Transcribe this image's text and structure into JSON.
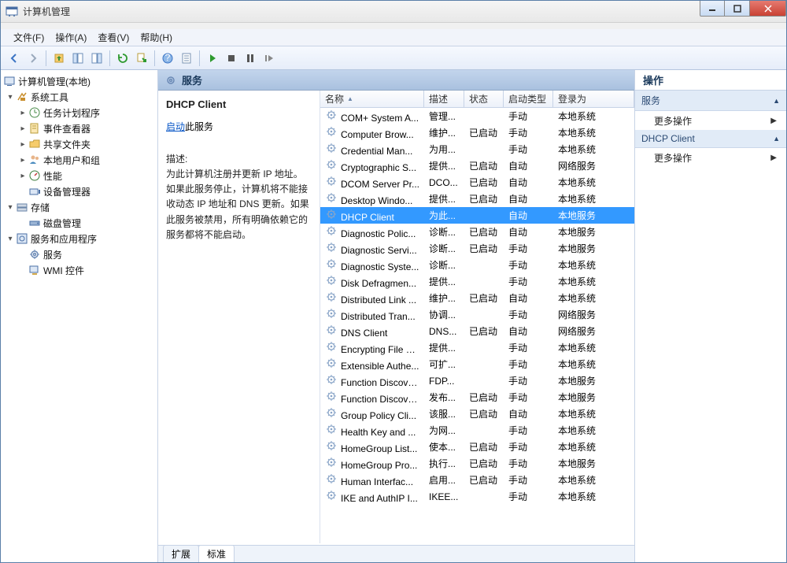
{
  "window": {
    "title": "计算机管理"
  },
  "menus": {
    "file": "文件(F)",
    "action": "操作(A)",
    "view": "查看(V)",
    "help": "帮助(H)"
  },
  "tree": {
    "root": "计算机管理(本地)",
    "sys_tools": "系统工具",
    "task_scheduler": "任务计划程序",
    "event_viewer": "事件查看器",
    "shared_folders": "共享文件夹",
    "local_users": "本地用户和组",
    "performance": "性能",
    "device_manager": "设备管理器",
    "storage": "存储",
    "disk_management": "磁盘管理",
    "services_apps": "服务和应用程序",
    "services": "服务",
    "wmi": "WMI 控件"
  },
  "content": {
    "header": "服务",
    "detail_title": "DHCP Client",
    "start_link_prefix": "启动",
    "start_link_suffix": "此服务",
    "desc_label": "描述:",
    "desc_text": "为此计算机注册并更新 IP 地址。如果此服务停止，计算机将不能接收动态 IP 地址和 DNS 更新。如果此服务被禁用，所有明确依赖它的服务都将不能启动。",
    "columns": {
      "name": "名称",
      "desc": "描述",
      "status": "状态",
      "startup": "启动类型",
      "logon": "登录为"
    },
    "rows": [
      {
        "name": "COM+ System A...",
        "desc": "管理...",
        "status": "",
        "startup": "手动",
        "logon": "本地系统"
      },
      {
        "name": "Computer Brow...",
        "desc": "维护...",
        "status": "已启动",
        "startup": "手动",
        "logon": "本地系统"
      },
      {
        "name": "Credential Man...",
        "desc": "为用...",
        "status": "",
        "startup": "手动",
        "logon": "本地系统"
      },
      {
        "name": "Cryptographic S...",
        "desc": "提供...",
        "status": "已启动",
        "startup": "自动",
        "logon": "网络服务"
      },
      {
        "name": "DCOM Server Pr...",
        "desc": "DCO...",
        "status": "已启动",
        "startup": "自动",
        "logon": "本地系统"
      },
      {
        "name": "Desktop Windo...",
        "desc": "提供...",
        "status": "已启动",
        "startup": "自动",
        "logon": "本地系统"
      },
      {
        "name": "DHCP Client",
        "desc": "为此...",
        "status": "",
        "startup": "自动",
        "logon": "本地服务",
        "selected": true
      },
      {
        "name": "Diagnostic Polic...",
        "desc": "诊断...",
        "status": "已启动",
        "startup": "自动",
        "logon": "本地服务"
      },
      {
        "name": "Diagnostic Servi...",
        "desc": "诊断...",
        "status": "已启动",
        "startup": "手动",
        "logon": "本地服务"
      },
      {
        "name": "Diagnostic Syste...",
        "desc": "诊断...",
        "status": "",
        "startup": "手动",
        "logon": "本地系统"
      },
      {
        "name": "Disk Defragmen...",
        "desc": "提供...",
        "status": "",
        "startup": "手动",
        "logon": "本地系统"
      },
      {
        "name": "Distributed Link ...",
        "desc": "维护...",
        "status": "已启动",
        "startup": "自动",
        "logon": "本地系统"
      },
      {
        "name": "Distributed Tran...",
        "desc": "协调...",
        "status": "",
        "startup": "手动",
        "logon": "网络服务"
      },
      {
        "name": "DNS Client",
        "desc": "DNS...",
        "status": "已启动",
        "startup": "自动",
        "logon": "网络服务"
      },
      {
        "name": "Encrypting File S...",
        "desc": "提供...",
        "status": "",
        "startup": "手动",
        "logon": "本地系统"
      },
      {
        "name": "Extensible Authe...",
        "desc": "可扩...",
        "status": "",
        "startup": "手动",
        "logon": "本地系统"
      },
      {
        "name": "Function Discove...",
        "desc": "FDP...",
        "status": "",
        "startup": "手动",
        "logon": "本地服务"
      },
      {
        "name": "Function Discove...",
        "desc": "发布...",
        "status": "已启动",
        "startup": "手动",
        "logon": "本地服务"
      },
      {
        "name": "Group Policy Cli...",
        "desc": "该服...",
        "status": "已启动",
        "startup": "自动",
        "logon": "本地系统"
      },
      {
        "name": "Health Key and ...",
        "desc": "为网...",
        "status": "",
        "startup": "手动",
        "logon": "本地系统"
      },
      {
        "name": "HomeGroup List...",
        "desc": "使本...",
        "status": "已启动",
        "startup": "手动",
        "logon": "本地系统"
      },
      {
        "name": "HomeGroup Pro...",
        "desc": "执行...",
        "status": "已启动",
        "startup": "手动",
        "logon": "本地服务"
      },
      {
        "name": "Human Interfac...",
        "desc": "启用...",
        "status": "已启动",
        "startup": "手动",
        "logon": "本地系统"
      },
      {
        "name": "IKE and AuthIP I...",
        "desc": "IKEE...",
        "status": "",
        "startup": "手动",
        "logon": "本地系统"
      }
    ],
    "tabs": {
      "extended": "扩展",
      "standard": "标准"
    }
  },
  "actions": {
    "header": "操作",
    "group1": "服务",
    "more1": "更多操作",
    "group2": "DHCP Client",
    "more2": "更多操作"
  }
}
